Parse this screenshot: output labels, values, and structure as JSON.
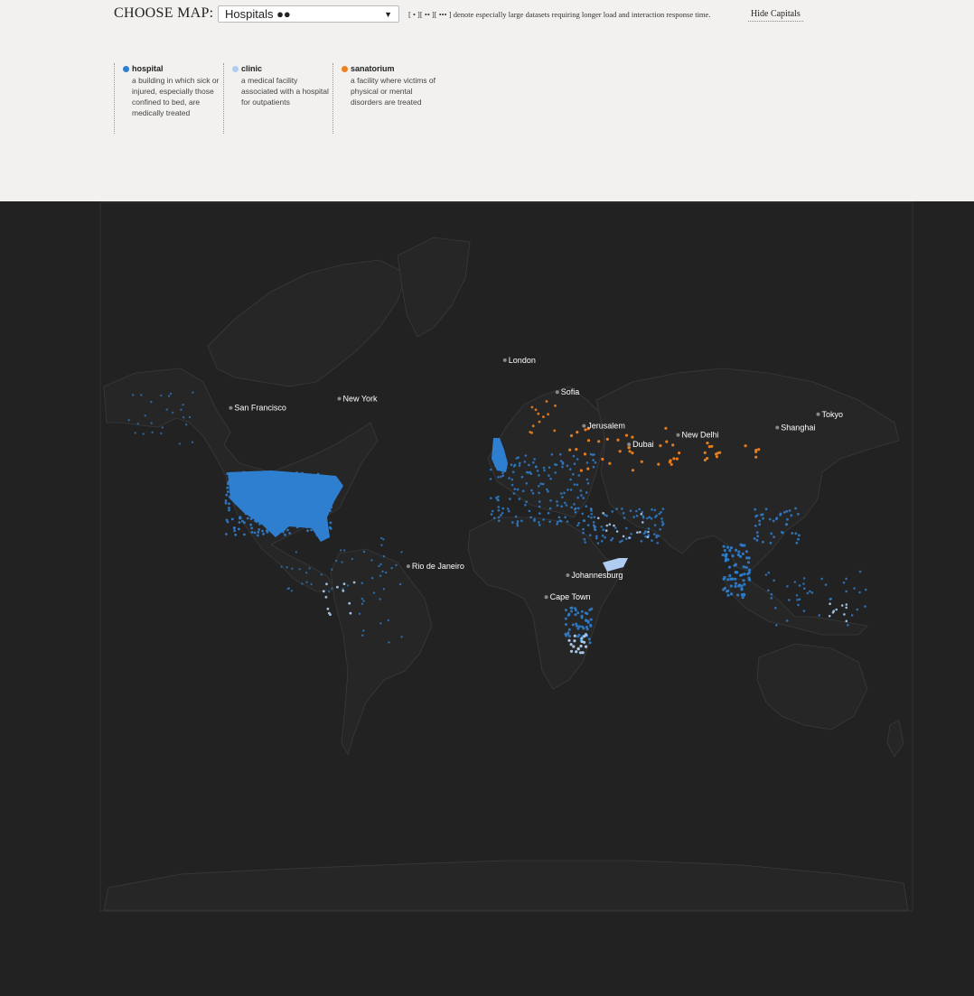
{
  "header": {
    "choose_label": "CHOOSE MAP:",
    "selected_map": "Hospitals ●●",
    "size_note": "[ • ][ •• ][ ••• ] denote especially large datasets requiring longer load and interaction response time.",
    "toggle_capitals_label": "Hide Capitals"
  },
  "legend": [
    {
      "name": "hospital",
      "description": "a building in which sick or injured, especially those confined to bed, are medically treated",
      "color": "#2f7fd0"
    },
    {
      "name": "clinic",
      "description": "a medical facility associated with a hospital for outpatients",
      "color": "#aecdf0"
    },
    {
      "name": "sanatorium",
      "description": "a facility where victims of physical or mental disorders are treated",
      "color": "#f07f1d"
    }
  ],
  "map": {
    "background_color": "#222222",
    "cities": [
      {
        "name": "San Francisco",
        "lat": 37.8,
        "lon": -122.4
      },
      {
        "name": "New York",
        "lat": 40.7,
        "lon": -74.0
      },
      {
        "name": "London",
        "lat": 51.5,
        "lon": -0.1
      },
      {
        "name": "Sofia",
        "lat": 42.7,
        "lon": 23.3
      },
      {
        "name": "Jerusalem",
        "lat": 31.8,
        "lon": 35.2
      },
      {
        "name": "Dubai",
        "lat": 25.2,
        "lon": 55.3
      },
      {
        "name": "New Delhi",
        "lat": 28.6,
        "lon": 77.2
      },
      {
        "name": "Shanghai",
        "lat": 31.2,
        "lon": 121.5
      },
      {
        "name": "Tokyo",
        "lat": 35.7,
        "lon": 139.7
      },
      {
        "name": "Rio de Janeiro",
        "lat": -22.9,
        "lon": -43.2
      },
      {
        "name": "Johannesburg",
        "lat": -26.2,
        "lon": 28.0
      },
      {
        "name": "Cape Town",
        "lat": -33.9,
        "lon": 18.4
      }
    ]
  }
}
